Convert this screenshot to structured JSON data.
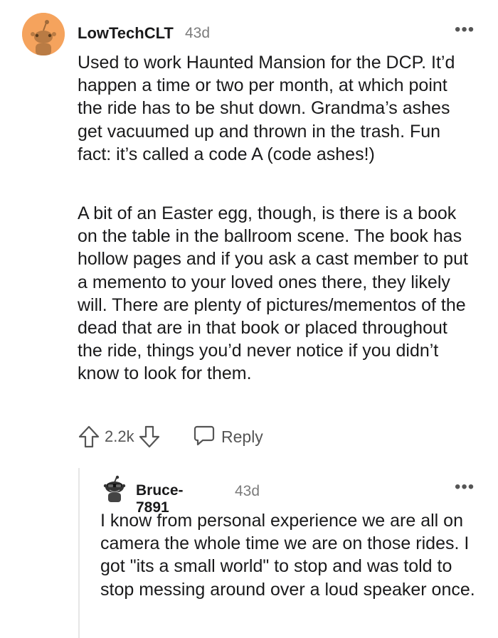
{
  "comment": {
    "username": "LowTechCLT",
    "age": "43d",
    "more": "•••",
    "paragraphs": [
      "Used to work Haunted Mansion for the DCP. It’d happen a time or two per month, at which point the ride has to be shut down. Grandma’s ashes get vacuumed up and thrown in the trash. Fun fact: it’s called a code A (code ashes!)",
      "A bit of an Easter egg, though, is there is a book on the table in the ballroom scene. The book has hollow pages and if you ask a cast member to put a memento to your loved ones there, they likely will. There are plenty of pictures/mementos of the dead that are in that book or placed throughout the ride, things you’d never notice if you didn’t know to look for them."
    ],
    "score": "2.2k",
    "reply_label": "Reply",
    "avatar_color": "#f5a35d"
  },
  "reply": {
    "username": "Bruce-7891",
    "age": "43d",
    "more": "•••",
    "text": "I know from personal experience we are all on camera the whole time we are on those rides. I got \"its a small world\" to stop and was told to stop messing around over a loud speaker once."
  },
  "icons": {
    "upvote": "upvote-arrow-icon",
    "downvote": "downvote-arrow-icon",
    "reply": "speech-bubble-icon",
    "more": "more-options-icon"
  }
}
